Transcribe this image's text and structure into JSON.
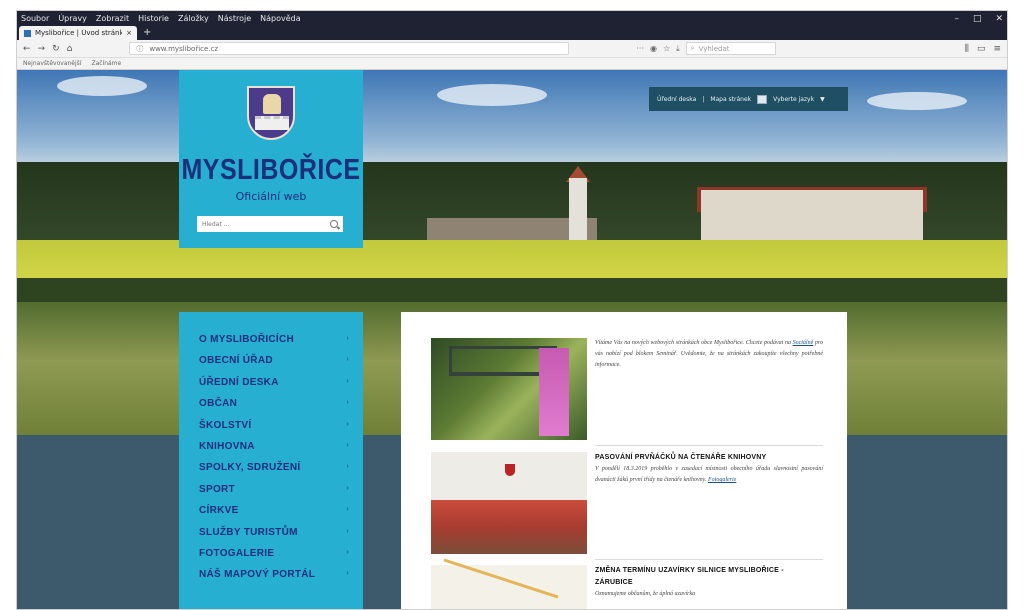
{
  "browser": {
    "menu": [
      "Soubor",
      "Úpravy",
      "Zobrazit",
      "Historie",
      "Záložky",
      "Nástroje",
      "Nápověda"
    ],
    "tab_title": "Myslibořice | Úvod stránky",
    "new_tab": "+",
    "url": "www.myslibořice.cz",
    "search_placeholder": "Vyhledat",
    "bookmarks": [
      "Nejnavštěvovanější",
      "Začínáme"
    ],
    "window_controls": [
      "–",
      "□",
      "✕"
    ]
  },
  "site": {
    "name": "MYSLIBOŘICE",
    "subtitle": "Oficiální web",
    "search_placeholder": "Hledat ...",
    "top_links": [
      "Úřední deska",
      "Mapa stránek",
      "Vyberte jazyk"
    ],
    "top_sep": "|",
    "lang_arrow": "▼"
  },
  "menu": [
    "O MYSLIBOŘICÍCH",
    "OBECNÍ ÚŘAD",
    "ÚŘEDNÍ DESKA",
    "OBČAN",
    "ŠKOLSTVÍ",
    "KNIHOVNA",
    "SPOLKY, SDRUŽENÍ",
    "SPORT",
    "CÍRKVE",
    "SLUŽBY TURISTŮM",
    "FOTOGALERIE",
    "NÁŠ MAPOVÝ PORTÁL"
  ],
  "menu_arrow": "›",
  "news": [
    {
      "title": "",
      "body_a": "Vítáme Vás na nových webových stránkách obce Myslibořice. Chcete podávat na ",
      "link": "Sociálně",
      "body_b": " pro vás nabízí pod blokem Seminář. Uvědomte, že na stránkách zakoupíte všechny potřebné informace."
    },
    {
      "title": "PASOVÁNÍ PRVŇÁČKŮ NA ČTENÁŘE KNIHOVNY",
      "body_a": "V pondělí 18.3.2019 proběhlo v zasedací místnosti obecního úřadu slavnostní pasování dvanácti žáků první třídy na čtenáře knihovny. ",
      "link": "Fotogalerie",
      "body_b": ""
    },
    {
      "title": "ZMĚNA TERMÍNU UZAVÍRKY SILNICE MYSLIBOŘICE - ZÁRUBICE",
      "body_a": "Oznamujeme občanům, že úplná uzavírka",
      "link": "",
      "body_b": ""
    }
  ]
}
